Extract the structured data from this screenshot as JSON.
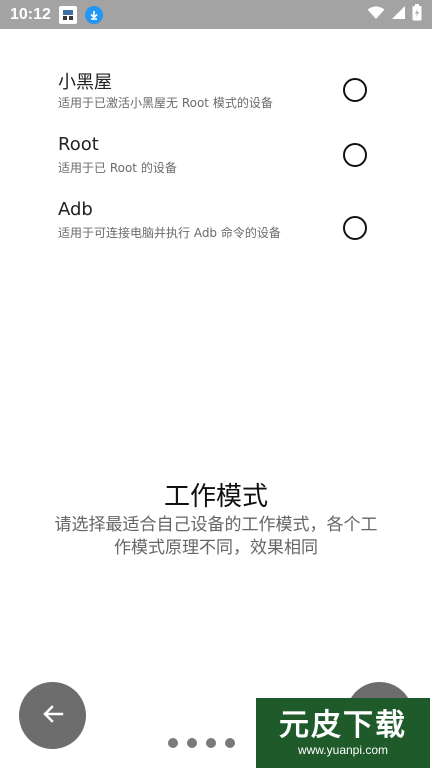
{
  "status_bar": {
    "time": "10:12",
    "notifications": [
      "app-icon",
      "download-icon"
    ],
    "indicators": [
      "wifi-icon",
      "signal-icon",
      "battery-icon"
    ]
  },
  "options": [
    {
      "title": "小黑屋",
      "desc": "适用于已激活小黑屋无 Root 模式的设备",
      "selected": false
    },
    {
      "title": "Root",
      "desc": "适用于已 Root 的设备",
      "selected": false
    },
    {
      "title": "Adb",
      "desc": "适用于可连接电脑并执行 Adb 命令的设备",
      "selected": false
    }
  ],
  "mode": {
    "title": "工作模式",
    "description": "请选择最适合自己设备的工作模式，各个工作模式原理不同，效果相同"
  },
  "nav": {
    "back_icon": "arrow-left-icon",
    "page_dots": 4
  },
  "watermark": {
    "logo": "元皮下载",
    "url": "www.yuanpi.com"
  }
}
